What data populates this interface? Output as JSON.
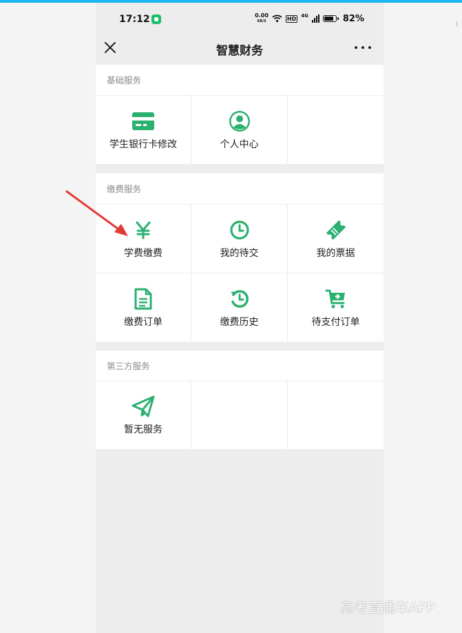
{
  "status_bar": {
    "time": "17:12",
    "speed_value": "0.00",
    "speed_unit": "KB/S",
    "hd": "HD",
    "network": "4G",
    "battery": "82%"
  },
  "nav": {
    "title": "智慧财务"
  },
  "colors": {
    "accent": "#2ab06f",
    "annotation": "#e53935"
  },
  "sections": [
    {
      "title": "基础服务",
      "items": [
        {
          "label": "学生银行卡修改",
          "icon": "bank-card-icon"
        },
        {
          "label": "个人中心",
          "icon": "user-circle-icon"
        }
      ]
    },
    {
      "title": "缴费服务",
      "items": [
        {
          "label": "学费缴费",
          "icon": "yen-icon"
        },
        {
          "label": "我的待交",
          "icon": "clock-icon"
        },
        {
          "label": "我的票据",
          "icon": "ticket-icon"
        },
        {
          "label": "缴费订单",
          "icon": "document-icon"
        },
        {
          "label": "缴费历史",
          "icon": "history-icon"
        },
        {
          "label": "待支付订单",
          "icon": "cart-plus-icon"
        }
      ]
    },
    {
      "title": "第三方服务",
      "items": [
        {
          "label": "暂无服务",
          "icon": "paper-plane-icon"
        }
      ]
    }
  ],
  "watermark": "高考直通车APP"
}
